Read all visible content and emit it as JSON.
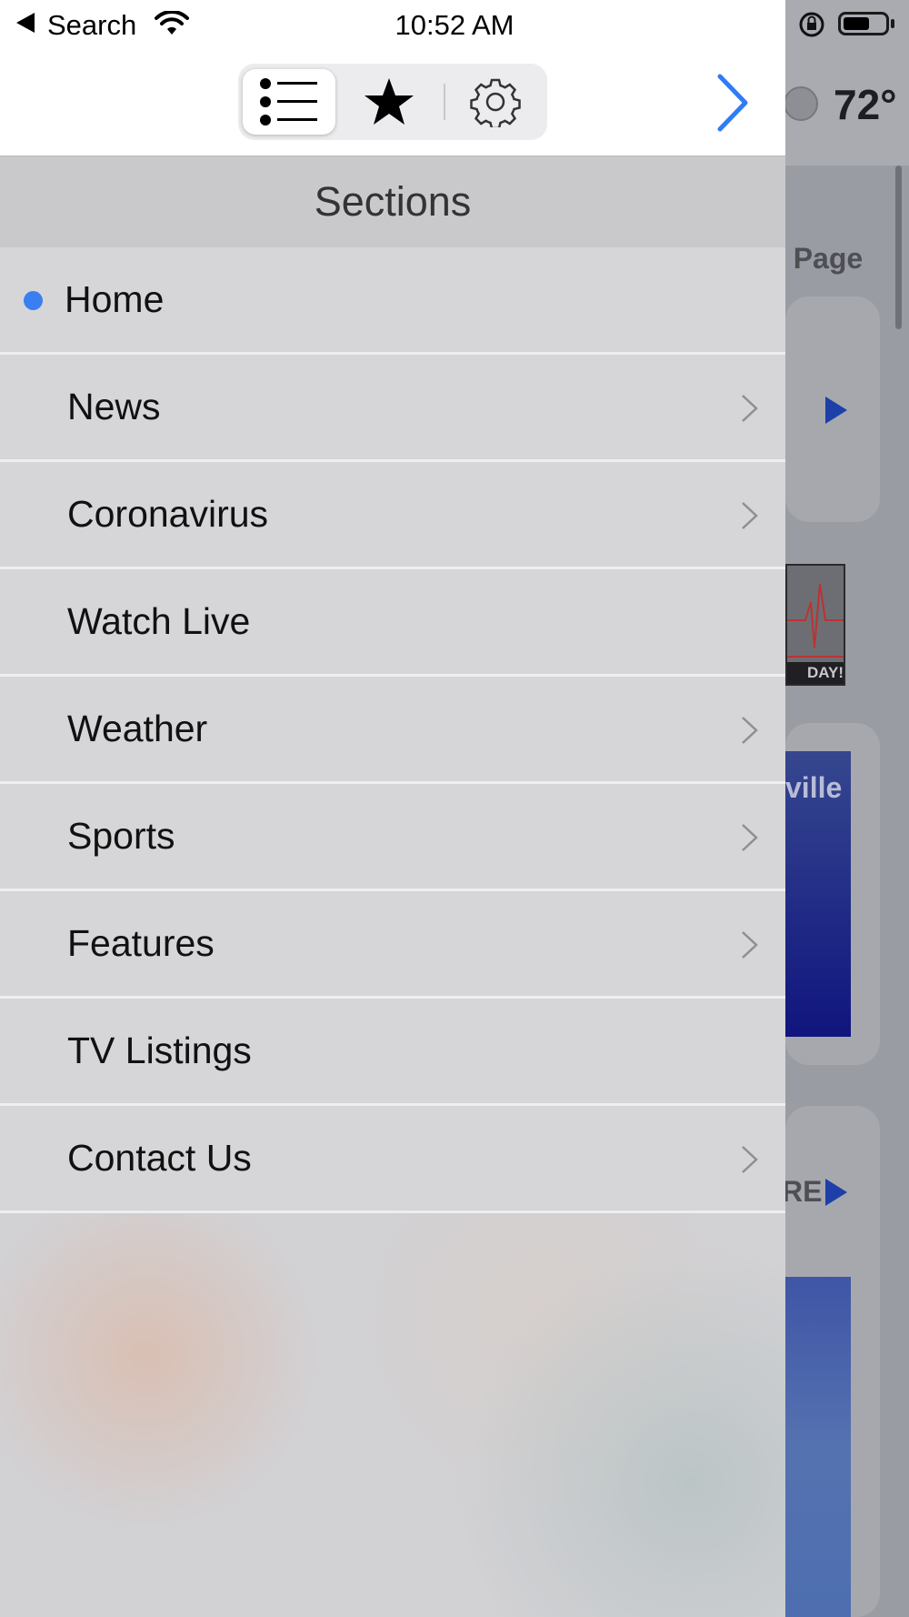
{
  "status_bar": {
    "back_label": "Search",
    "time": "10:52 AM"
  },
  "toolbar": {
    "tabs": [
      {
        "icon": "list-icon",
        "active": true
      },
      {
        "icon": "star-icon",
        "active": false
      },
      {
        "icon": "gear-icon",
        "active": false
      }
    ],
    "forward_icon": "chevron-right-icon"
  },
  "drawer": {
    "title": "Sections",
    "items": [
      {
        "label": "Home",
        "selected": true,
        "has_chevron": false
      },
      {
        "label": "News",
        "selected": false,
        "has_chevron": true
      },
      {
        "label": "Coronavirus",
        "selected": false,
        "has_chevron": true
      },
      {
        "label": "Watch Live",
        "selected": false,
        "has_chevron": false
      },
      {
        "label": "Weather",
        "selected": false,
        "has_chevron": true
      },
      {
        "label": "Sports",
        "selected": false,
        "has_chevron": true
      },
      {
        "label": "Features",
        "selected": false,
        "has_chevron": true
      },
      {
        "label": "TV Listings",
        "selected": false,
        "has_chevron": false
      },
      {
        "label": "Contact Us",
        "selected": false,
        "has_chevron": true
      }
    ]
  },
  "background": {
    "temperature": "72°",
    "page_label": "e Page",
    "blue_card_text": "ville",
    "ecg_caption": "DAY!",
    "more_label": "RE"
  },
  "colors": {
    "accent": "#3a7ff0",
    "link_blue": "#2f7cf6"
  }
}
